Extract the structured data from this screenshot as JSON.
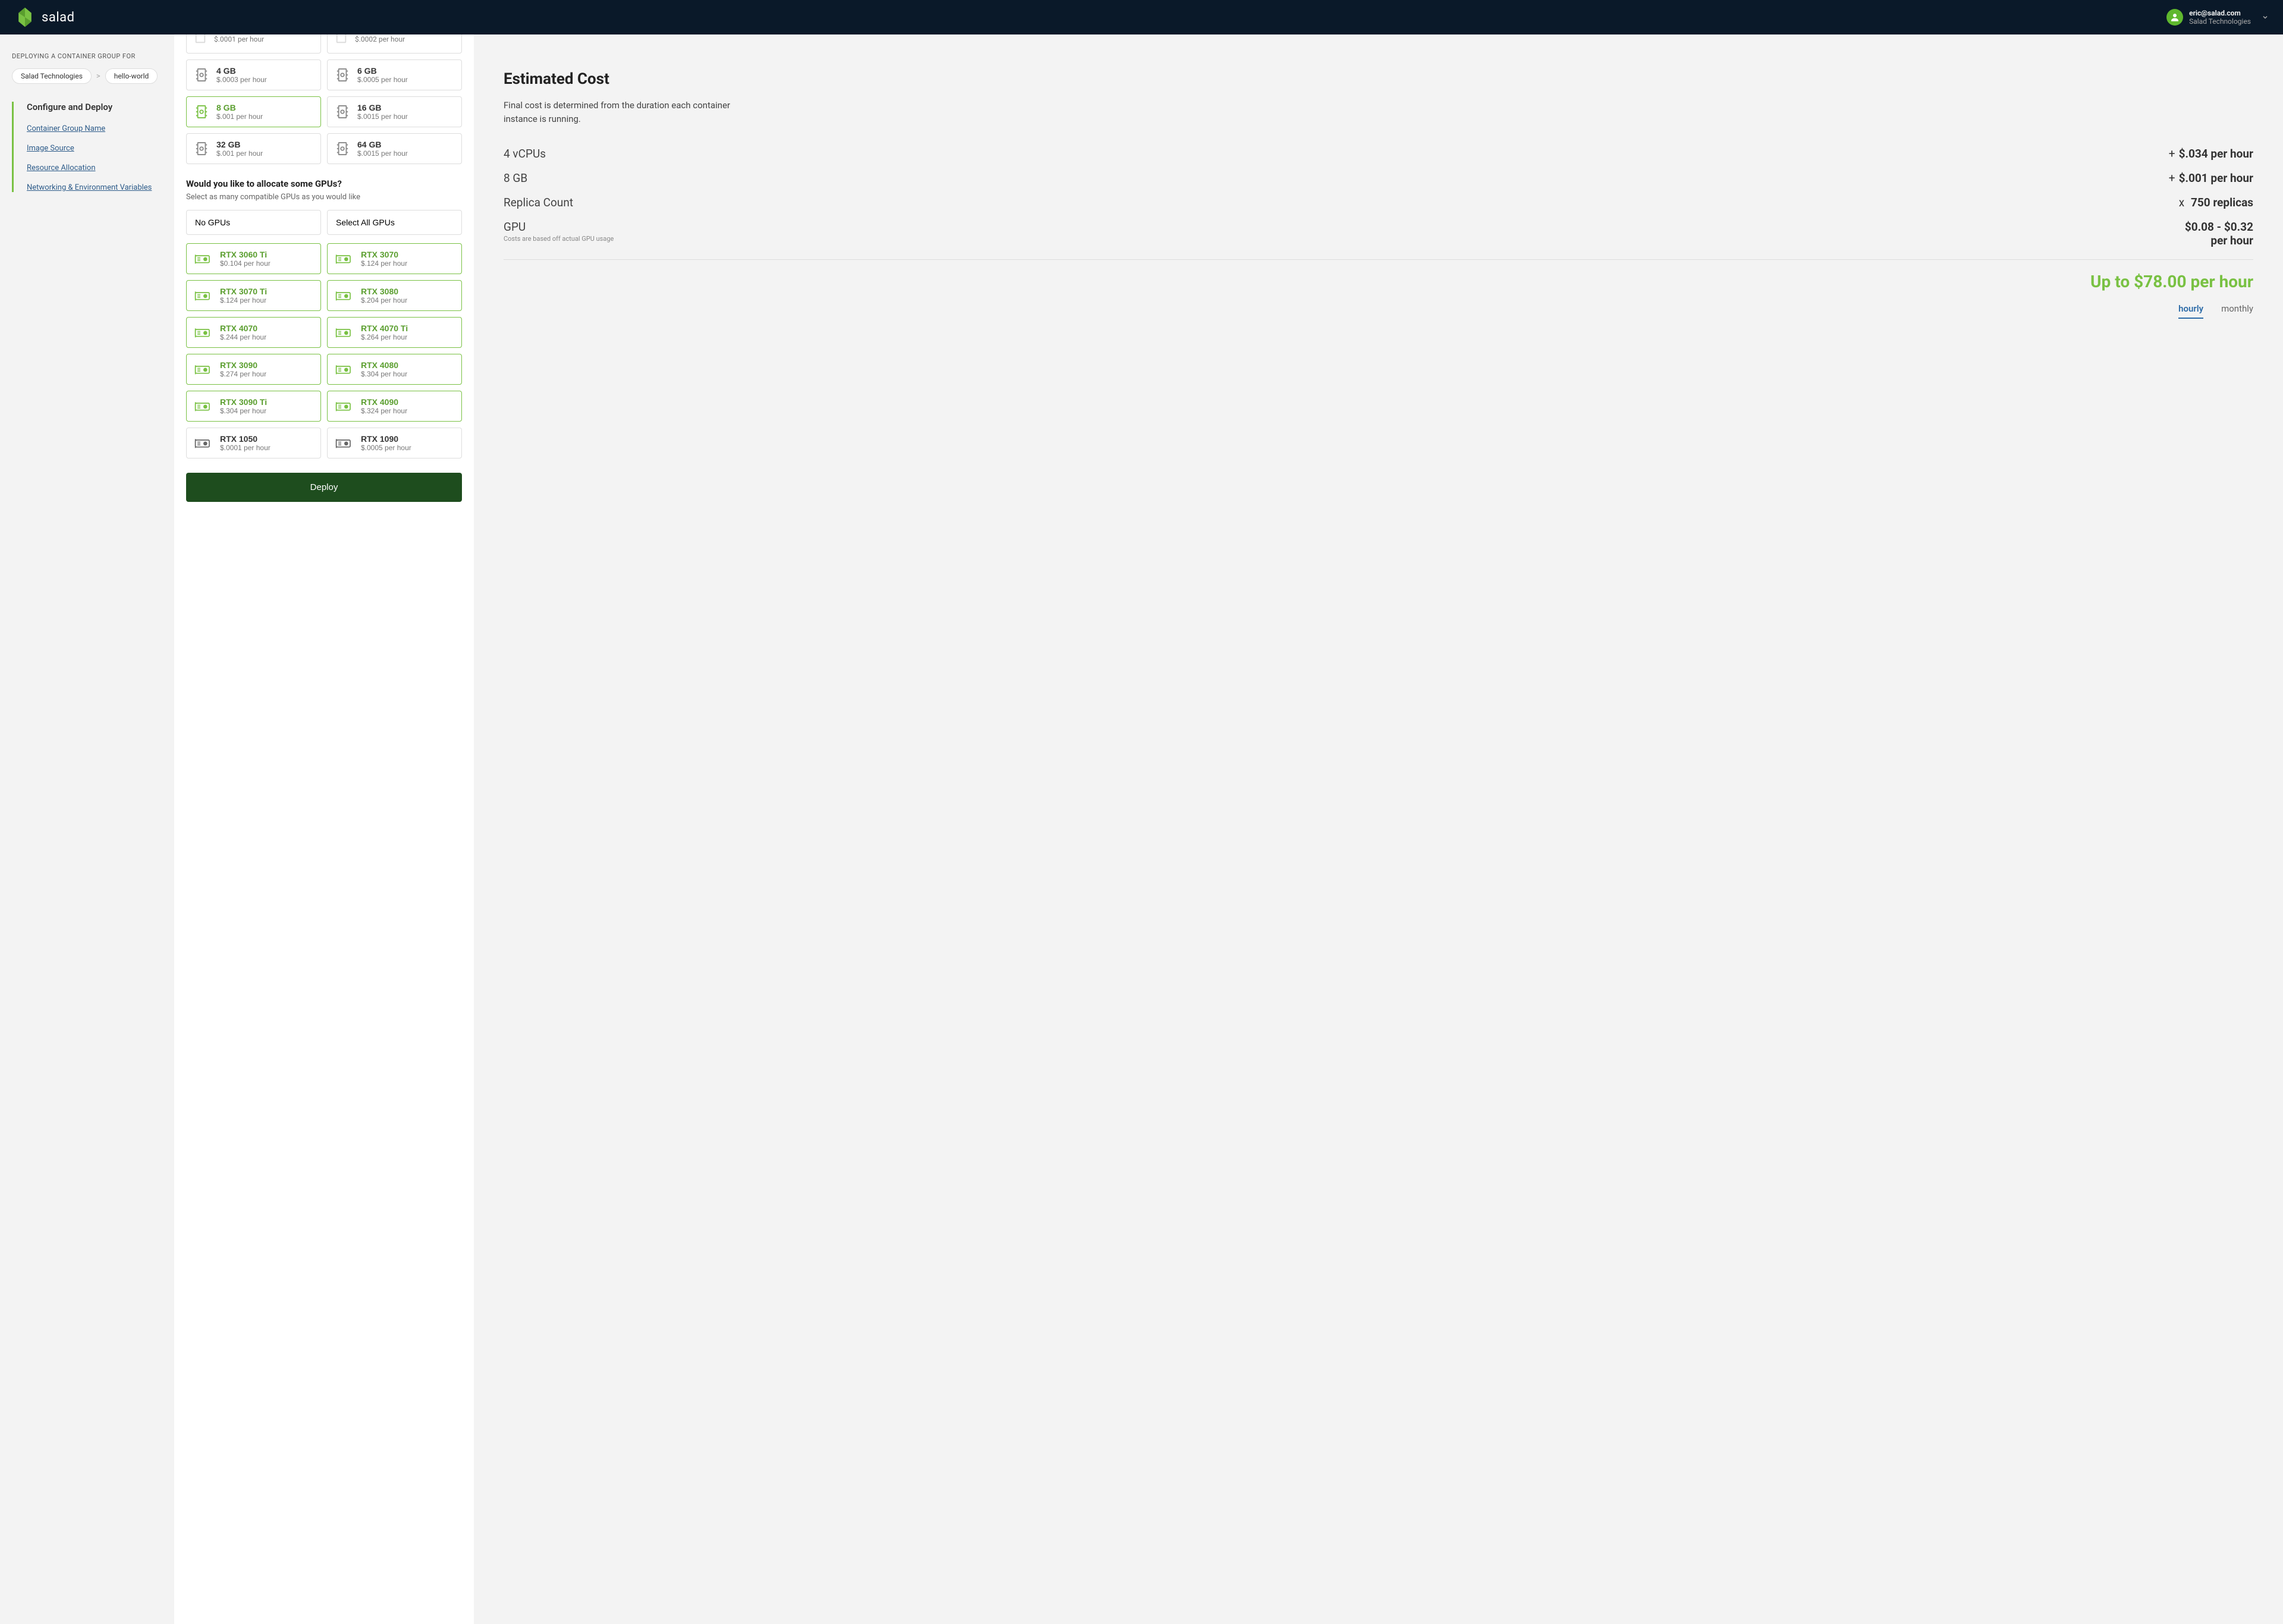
{
  "brand": "salad",
  "user": {
    "email": "eric@salad.com",
    "org": "Salad Technologies"
  },
  "sidebar": {
    "deploy_label": "DEPLOYING A CONTAINER GROUP FOR",
    "crumb_org": "Salad Technologies",
    "crumb_project": "hello-world",
    "section_title": "Configure and Deploy",
    "links": {
      "name": "Container Group Name",
      "image": "Image Source",
      "resource": "Resource Allocation",
      "network": "Networking & Environment Variables"
    }
  },
  "ram_partial": [
    {
      "sub": "$.0001 per hour"
    },
    {
      "sub": "$.0002 per hour"
    }
  ],
  "ram": [
    {
      "title": "4 GB",
      "sub": "$.0003 per hour",
      "selected": false
    },
    {
      "title": "6 GB",
      "sub": "$.0005 per hour",
      "selected": false
    },
    {
      "title": "8 GB",
      "sub": "$.001 per hour",
      "selected": true
    },
    {
      "title": "16 GB",
      "sub": "$.0015 per hour",
      "selected": false
    },
    {
      "title": "32 GB",
      "sub": "$.001 per hour",
      "selected": false
    },
    {
      "title": "64 GB",
      "sub": "$.0015 per hour",
      "selected": false
    }
  ],
  "gpu_section": {
    "title": "Would you like to allocate some GPUs?",
    "sub": "Select as many compatible GPUs as you would like",
    "no_gpus": "No GPUs",
    "all_gpus": "Select All GPUs"
  },
  "gpus": [
    {
      "title": "RTX 3060 Ti",
      "sub": "$0.104 per hour",
      "selected": true
    },
    {
      "title": "RTX 3070",
      "sub": "$.124 per hour",
      "selected": true
    },
    {
      "title": "RTX 3070 Ti",
      "sub": "$.124 per hour",
      "selected": true
    },
    {
      "title": "RTX 3080",
      "sub": "$.204 per hour",
      "selected": true
    },
    {
      "title": "RTX 4070",
      "sub": "$.244 per hour",
      "selected": true
    },
    {
      "title": "RTX 4070 Ti",
      "sub": "$.264 per hour",
      "selected": true
    },
    {
      "title": "RTX 3090",
      "sub": "$.274 per hour",
      "selected": true
    },
    {
      "title": "RTX 4080",
      "sub": "$.304 per hour",
      "selected": true
    },
    {
      "title": "RTX 3090 Ti",
      "sub": "$.304 per hour",
      "selected": true
    },
    {
      "title": "RTX 4090",
      "sub": "$.324 per hour",
      "selected": true
    },
    {
      "title": "RTX 1050",
      "sub": "$.0001 per hour",
      "selected": false
    },
    {
      "title": "RTX 1090",
      "sub": "$.0005 per hour",
      "selected": false
    }
  ],
  "deploy_label": "Deploy",
  "cost": {
    "title": "Estimated Cost",
    "desc": "Final cost is determined from the duration each container instance is running.",
    "rows": {
      "vcpu": {
        "label": "4 vCPUs",
        "prefix": "+",
        "value": "$.034 per hour"
      },
      "ram": {
        "label": "8 GB",
        "prefix": "+",
        "value": "$.001 per hour"
      },
      "replicas": {
        "label": "Replica Count",
        "prefix": "x",
        "value": "750 replicas"
      },
      "gpu": {
        "label": "GPU",
        "note": "Costs are based off actual GPU usage",
        "value": "$0.08 - $0.32 per hour"
      }
    },
    "total": "Up to $78.00 per hour",
    "tab_hourly": "hourly",
    "tab_monthly": "monthly"
  }
}
